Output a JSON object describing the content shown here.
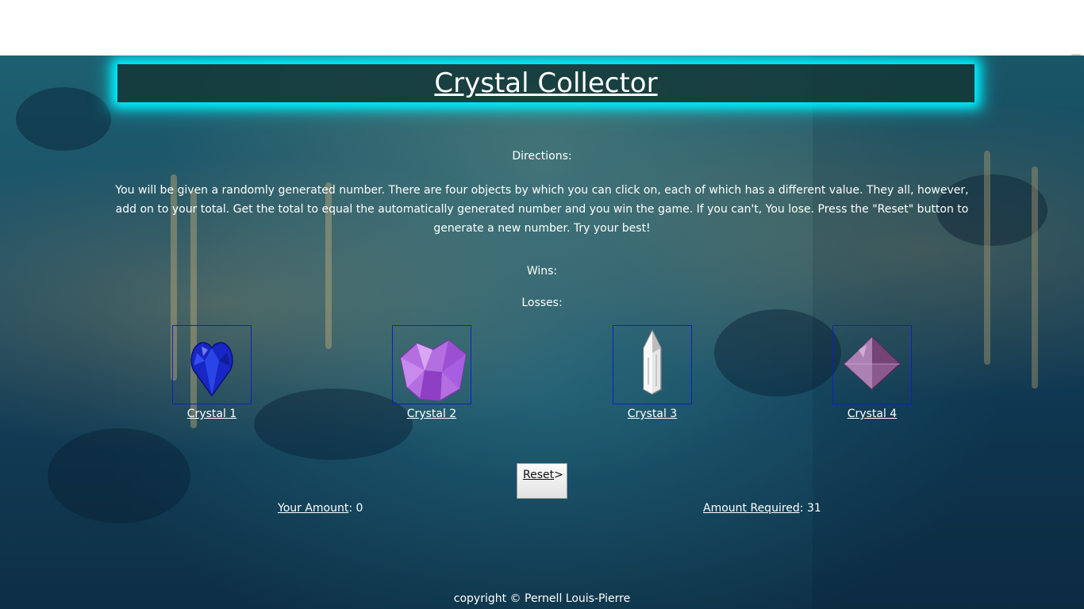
{
  "header": {
    "title": "Crystal Collector"
  },
  "directions": {
    "label": "Directions:",
    "body": "You will be given a randomly generated number. There are four objects by which you can click on, each of which has a different value. They all, however, add on to your total. Get the total to equal the automatically generated number and you win the game. If you can't, You lose. Press the \"Reset\" button to generate a new number. Try your best!"
  },
  "stats": {
    "wins_label": "Wins:",
    "losses_label": "Losses:"
  },
  "crystals": [
    {
      "label": "Crystal 1",
      "icon": "blue-heart-crystal-icon",
      "color": "#1a2bd0"
    },
    {
      "label": "Crystal 2",
      "icon": "purple-crystal-cluster-icon",
      "color": "#b36ee0"
    },
    {
      "label": "Crystal 3",
      "icon": "clear-quartz-crystal-icon",
      "color": "#e8e8e8"
    },
    {
      "label": "Crystal 4",
      "icon": "violet-octahedron-crystal-icon",
      "color": "#8a5a8c"
    }
  ],
  "reset": {
    "label": "Reset",
    "suffix": ">"
  },
  "amounts": {
    "your_label": "Your Amount",
    "your_value": "0",
    "required_label": "Amount Required",
    "required_value": "31"
  },
  "footer": {
    "text": "copyright © Pernell Louis-Pierre"
  },
  "colors": {
    "glow": "#00f0ff",
    "crystal_border": "#1020c0"
  }
}
